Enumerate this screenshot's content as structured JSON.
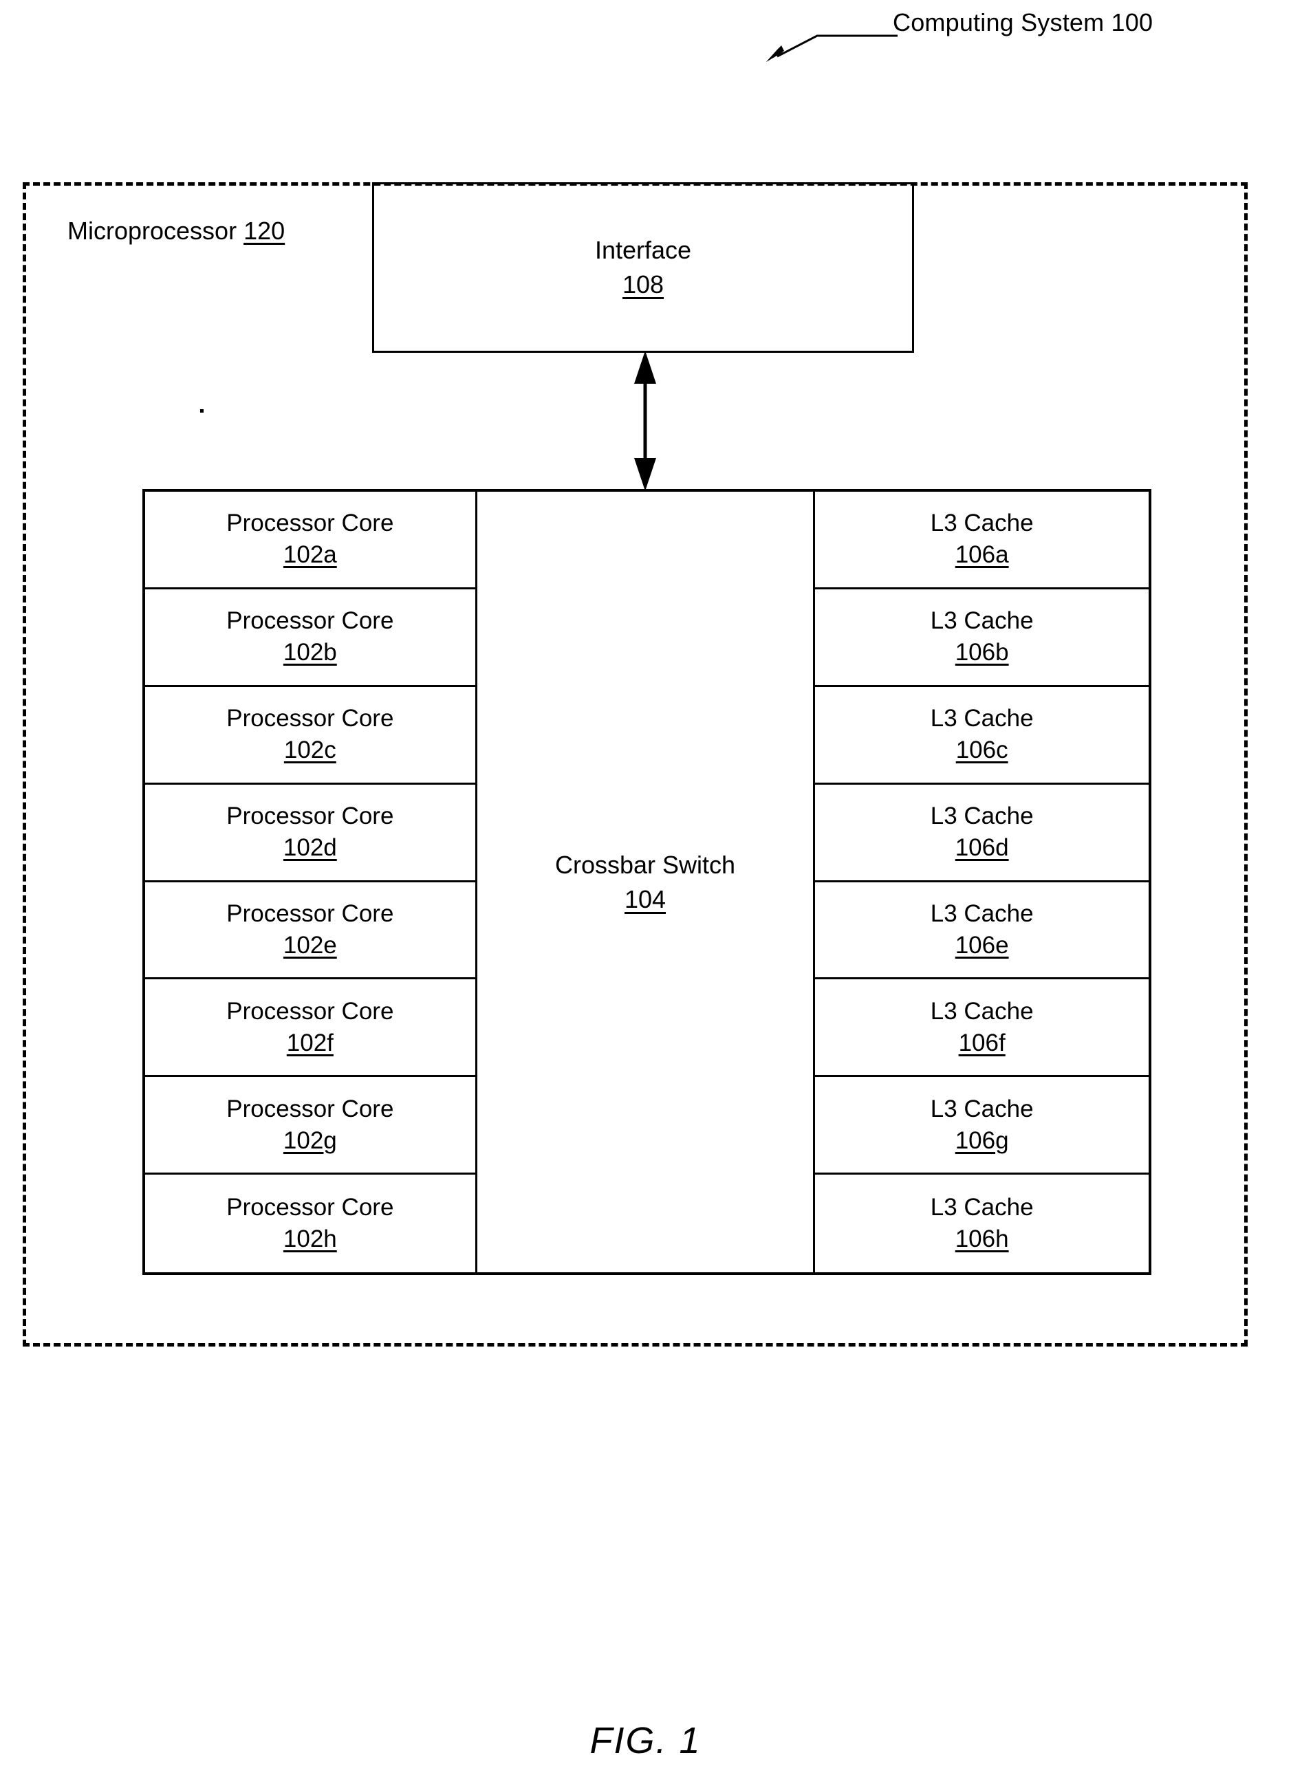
{
  "figure": {
    "caption": "FIG. 1",
    "system_callout": "Computing System 100"
  },
  "microprocessor": {
    "label_text": "Microprocessor",
    "label_ref": "120"
  },
  "interface": {
    "name": "Interface",
    "ref": "108"
  },
  "crossbar": {
    "name": "Crossbar Switch",
    "ref": "104"
  },
  "processor_cores": {
    "column_label": "Processor Core",
    "items": [
      {
        "name": "Processor Core",
        "ref": "102a"
      },
      {
        "name": "Processor Core",
        "ref": "102b"
      },
      {
        "name": "Processor Core",
        "ref": "102c"
      },
      {
        "name": "Processor Core",
        "ref": "102d"
      },
      {
        "name": "Processor Core",
        "ref": "102e"
      },
      {
        "name": "Processor Core",
        "ref": "102f"
      },
      {
        "name": "Processor Core",
        "ref": "102g"
      },
      {
        "name": "Processor Core",
        "ref": "102h"
      }
    ]
  },
  "l3_caches": {
    "column_label": "L3 Cache",
    "items": [
      {
        "name": "L3 Cache",
        "ref": "106a"
      },
      {
        "name": "L3 Cache",
        "ref": "106b"
      },
      {
        "name": "L3 Cache",
        "ref": "106c"
      },
      {
        "name": "L3 Cache",
        "ref": "106d"
      },
      {
        "name": "L3 Cache",
        "ref": "106e"
      },
      {
        "name": "L3 Cache",
        "ref": "106f"
      },
      {
        "name": "L3 Cache",
        "ref": "106g"
      },
      {
        "name": "L3 Cache",
        "ref": "106h"
      }
    ]
  },
  "connectors": {
    "interface_to_crossbar": "bidirectional-arrow"
  },
  "colors": {
    "ink": "#000000",
    "paper": "#ffffff"
  }
}
